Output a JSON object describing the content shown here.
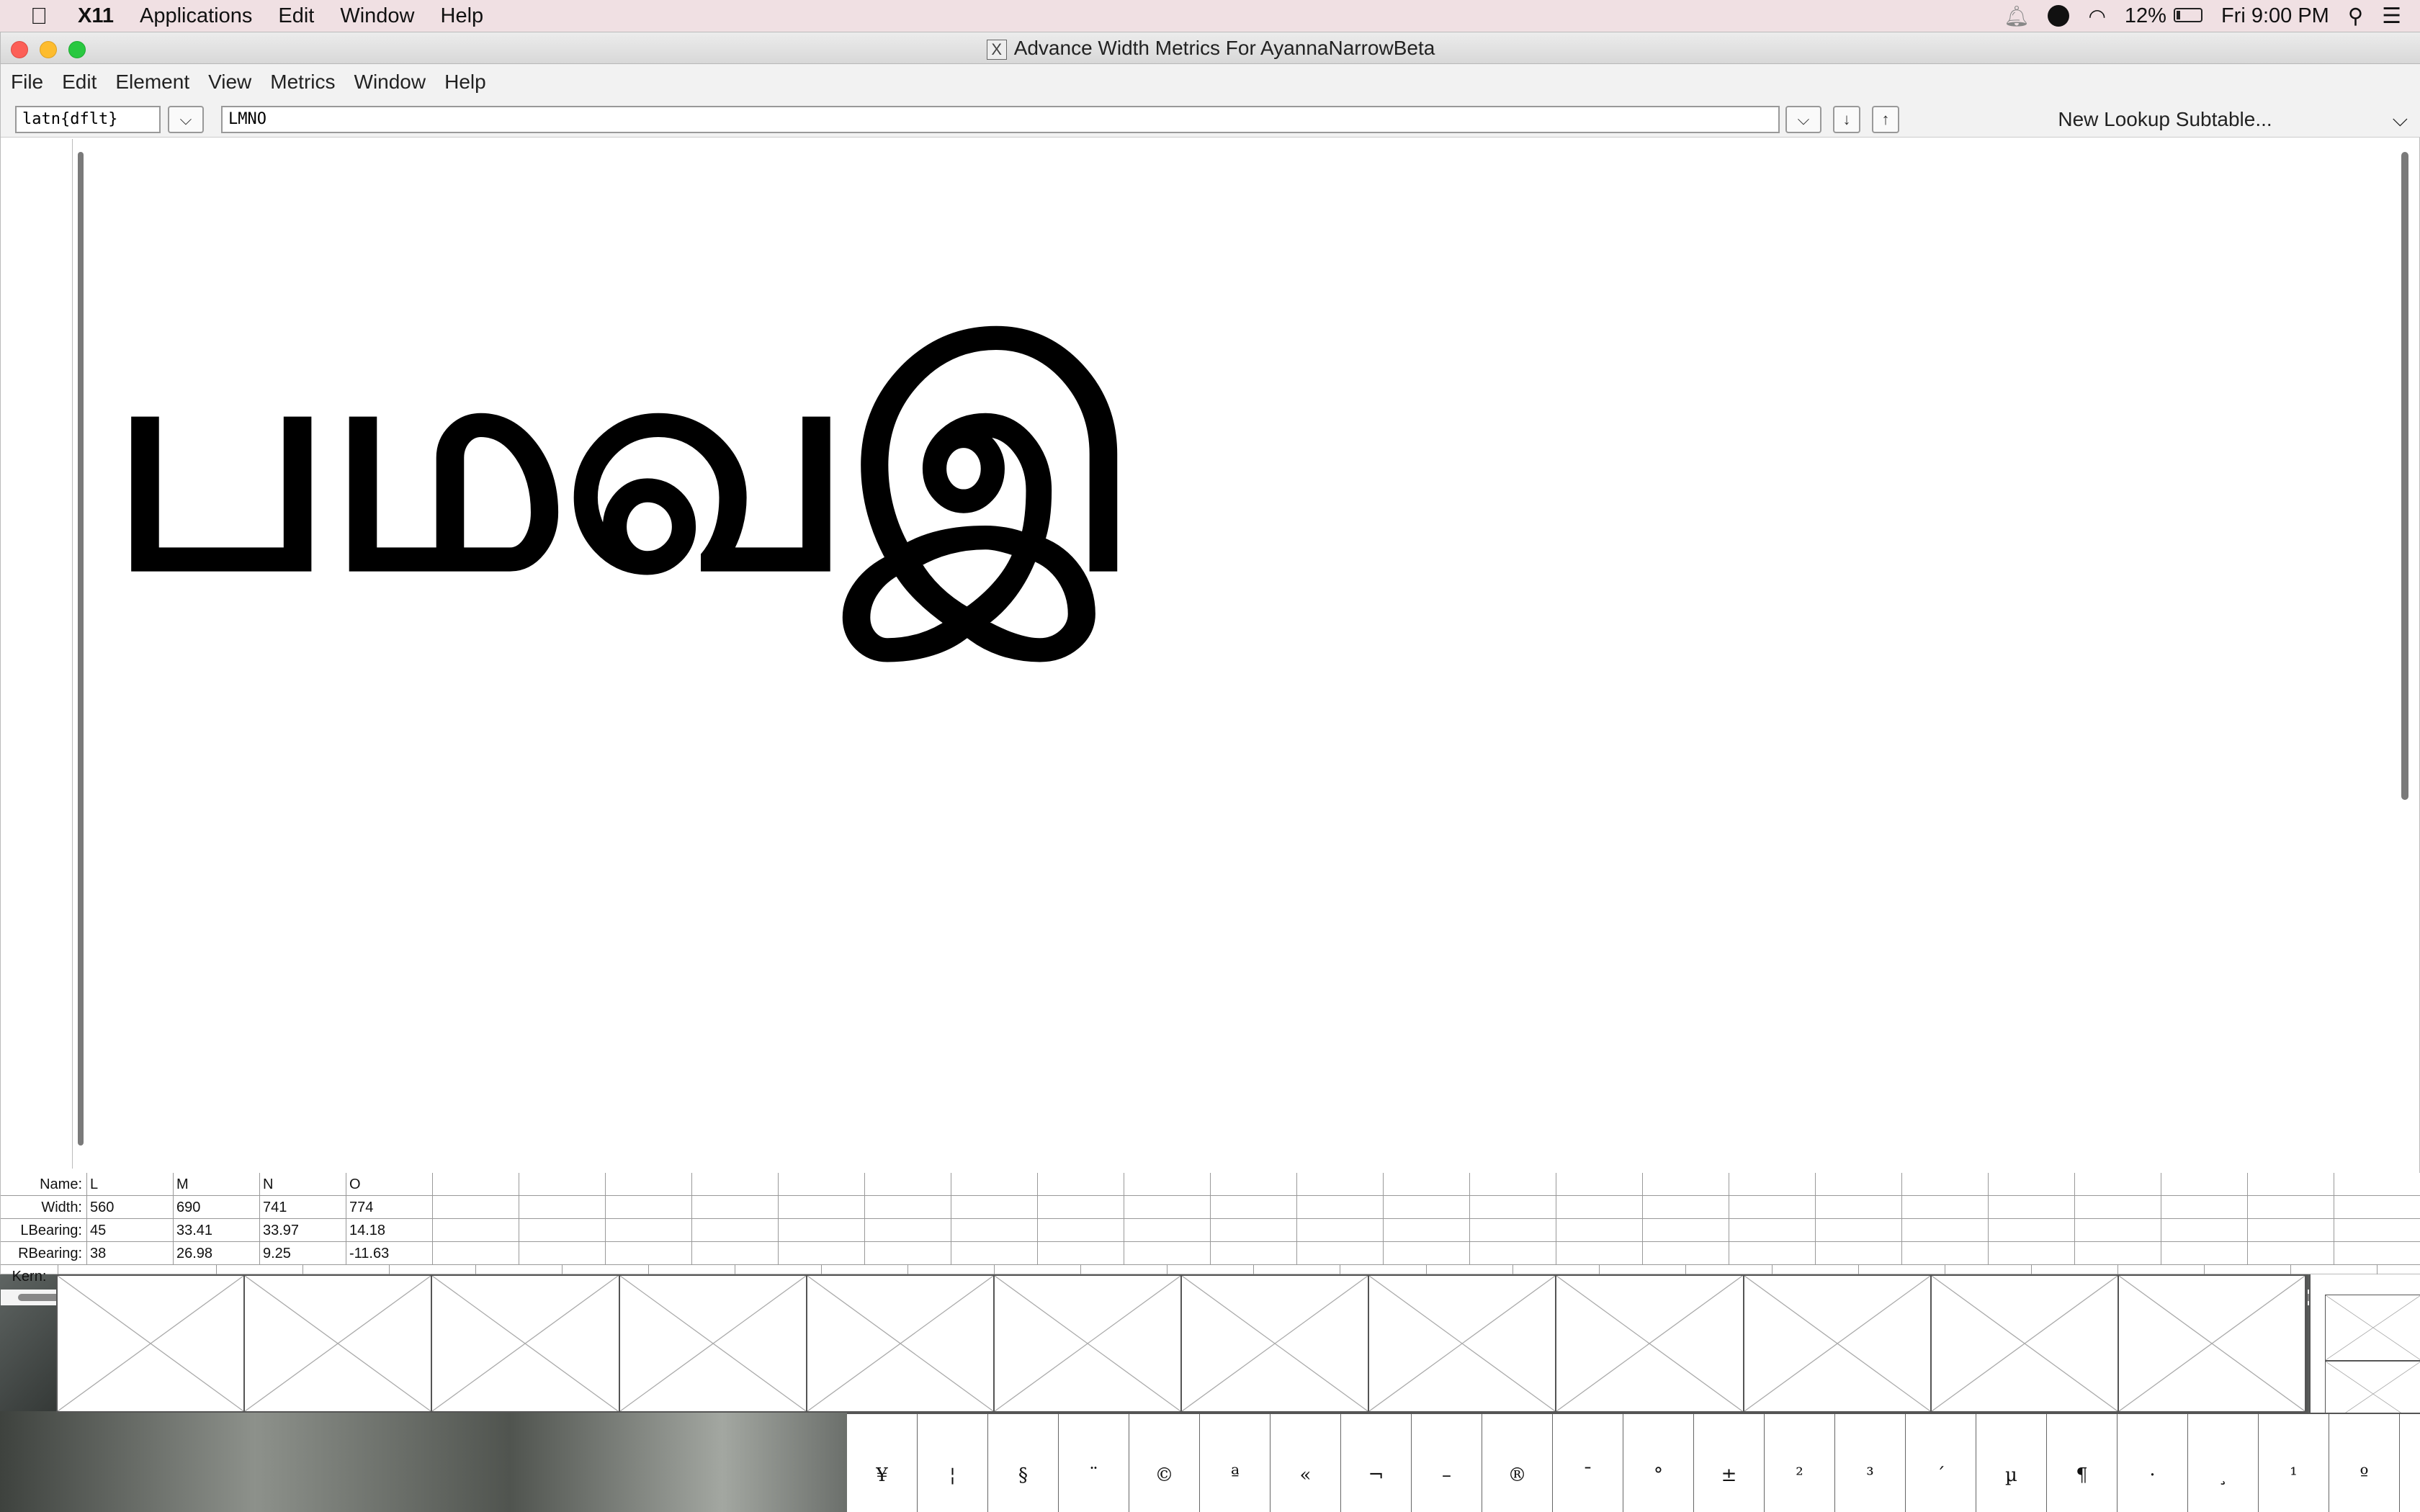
{
  "menubar": {
    "app": "X11",
    "items": [
      "Applications",
      "Edit",
      "Window",
      "Help"
    ],
    "battery": "12%",
    "clock": "Fri 9:00 PM"
  },
  "window": {
    "title": "Advance Width Metrics For AyannaNarrowBeta",
    "menu": [
      "File",
      "Edit",
      "Element",
      "View",
      "Metrics",
      "Window",
      "Help"
    ]
  },
  "toolbar": {
    "script_value": "latn{dflt}",
    "text_value": "LMNO",
    "btn_prev": "↓",
    "btn_next": "↑",
    "lookup": "New Lookup Subtable..."
  },
  "canvas": {
    "glyphs": "பமவஇ"
  },
  "metrics": {
    "labels": {
      "name": "Name:",
      "width": "Width:",
      "lbearing": "LBearing:",
      "rbearing": "RBearing:",
      "kern": "Kern:"
    },
    "columns": [
      {
        "name": "L",
        "width": "560",
        "lbearing": "45",
        "rbearing": "38"
      },
      {
        "name": "M",
        "width": "690",
        "lbearing": "33.41",
        "rbearing": "26.98"
      },
      {
        "name": "N",
        "width": "741",
        "lbearing": "33.97",
        "rbearing": "9.25"
      },
      {
        "name": "O",
        "width": "774",
        "lbearing": "14.18",
        "rbearing": "-11.63"
      }
    ]
  },
  "fontview": {
    "glyph_row": [
      "¥",
      "¦",
      "§",
      "¨",
      "©",
      "ª",
      "«",
      "¬",
      "–",
      "®",
      "¯",
      "°",
      "±",
      "²",
      "³",
      "´",
      "µ",
      "¶",
      "·",
      "¸",
      "¹",
      "º"
    ]
  }
}
